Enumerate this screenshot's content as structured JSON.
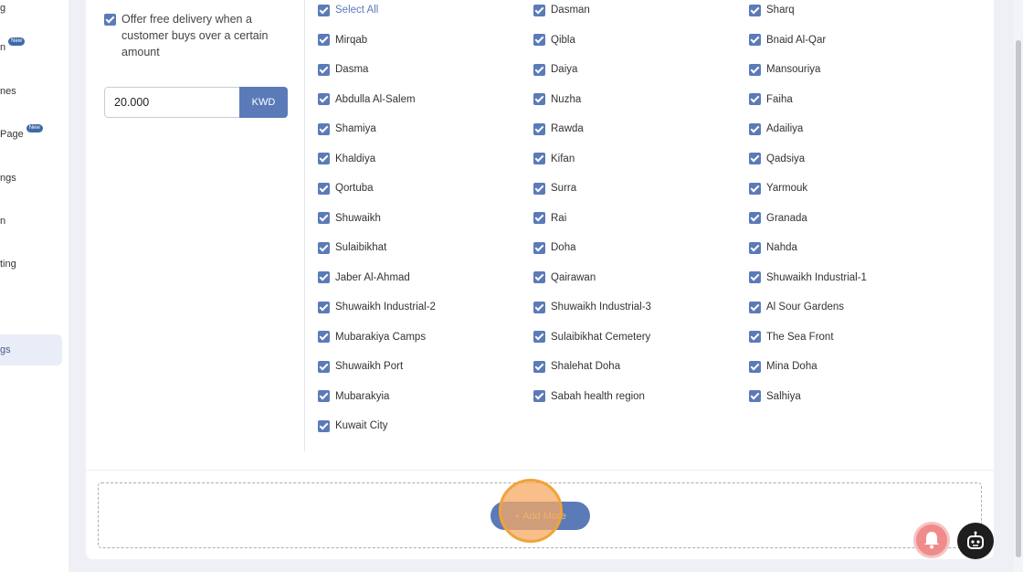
{
  "sidebar": {
    "items": [
      {
        "label": "g",
        "badge": ""
      },
      {
        "label": "n",
        "badge": "New"
      },
      {
        "label": "nes",
        "badge": ""
      },
      {
        "label": "Page",
        "badge": "New"
      },
      {
        "label": "ngs",
        "badge": ""
      },
      {
        "label": "n",
        "badge": ""
      },
      {
        "label": "ting",
        "badge": ""
      },
      {
        "label": "gs",
        "badge": ""
      }
    ]
  },
  "delivery": {
    "free_delivery_label": "Offer free delivery when a customer buys over a certain amount",
    "amount_value": "20.000",
    "currency": "KWD"
  },
  "areas": {
    "col1": [
      "Select All",
      "Mirqab",
      "Dasma",
      "Abdulla Al-Salem",
      "Shamiya",
      "Khaldiya",
      "Qortuba",
      "Shuwaikh",
      "Sulaibikhat",
      "Jaber Al-Ahmad",
      "Shuwaikh Industrial-2",
      "Mubarakiya Camps",
      "Shuwaikh Port",
      "Mubarakyia",
      "Kuwait City"
    ],
    "col2": [
      "Dasman",
      "Qibla",
      "Daiya",
      "Nuzha",
      "Rawda",
      "Kifan",
      "Surra",
      "Rai",
      "Doha",
      "Qairawan",
      "Shuwaikh Industrial-3",
      "Sulaibikhat Cemetery",
      "Shalehat Doha",
      "Sabah health region"
    ],
    "col3": [
      "Sharq",
      "Bnaid Al-Qar",
      "Mansouriya",
      "Faiha",
      "Adailiya",
      "Qadsiya",
      "Yarmouk",
      "Granada",
      "Nahda",
      "Shuwaikh Industrial-1",
      "Al Sour Gardens",
      "The Sea Front",
      "Mina Doha",
      "Salhiya"
    ]
  },
  "actions": {
    "add_more_label": "+ Add More"
  },
  "colors": {
    "accent": "#5b7ab8",
    "background": "#eef0f6"
  }
}
